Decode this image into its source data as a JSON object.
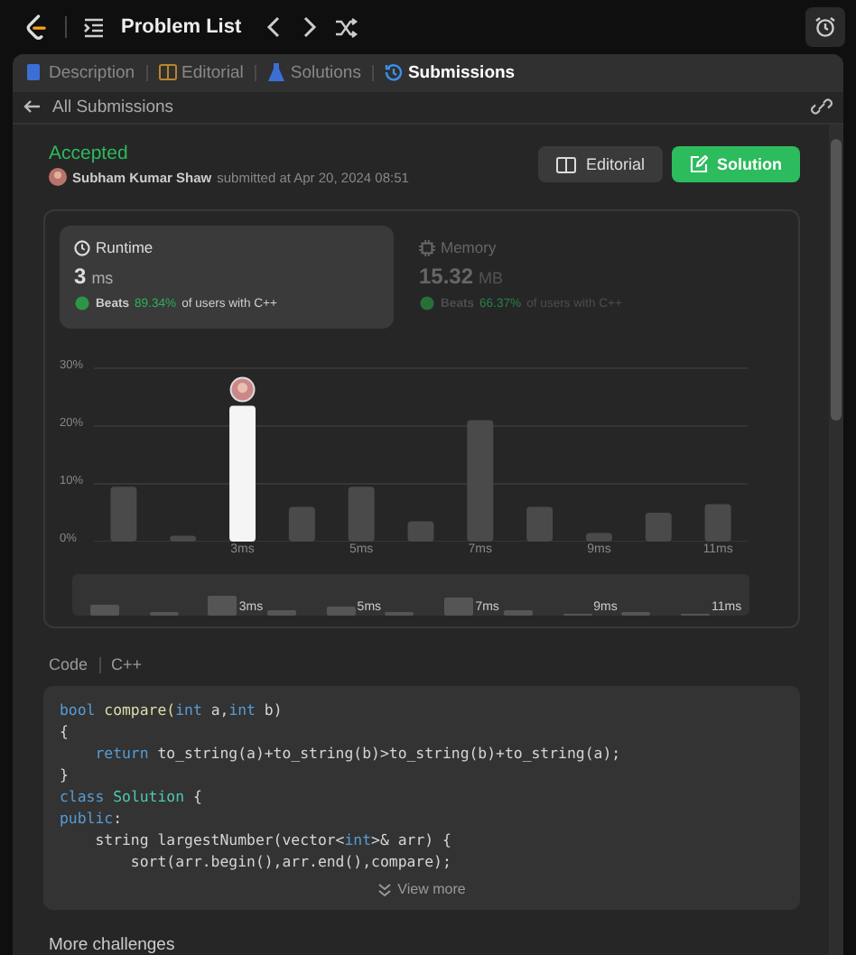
{
  "topbar": {
    "title": "Problem List"
  },
  "tabs": [
    {
      "label": "Description",
      "selected": false
    },
    {
      "label": "Editorial",
      "selected": false
    },
    {
      "label": "Solutions",
      "selected": false
    },
    {
      "label": "Submissions",
      "selected": true
    }
  ],
  "back_link": "All Submissions",
  "result": {
    "status": "Accepted",
    "user": "Subham Kumar Shaw",
    "submitted": "submitted at Apr 20, 2024 08:51"
  },
  "buttons": [
    {
      "label": "Editorial",
      "kind": "secondary"
    },
    {
      "label": "Solution",
      "kind": "primary"
    }
  ],
  "stats": [
    {
      "title": "Runtime",
      "value": "3",
      "unit": "ms",
      "beats_label": "Beats",
      "beats": "89.34%",
      "beats_suffix": "of users with C++",
      "selected": true
    },
    {
      "title": "Memory",
      "value": "15.32",
      "unit": "MB",
      "beats_label": "Beats",
      "beats": "66.37%",
      "beats_suffix": "of users with C++",
      "selected": false
    }
  ],
  "distribution": {
    "chart_data": {
      "type": "bar",
      "categories": [
        null,
        null,
        "3ms",
        null,
        "5ms",
        null,
        "7ms",
        null,
        "9ms",
        null,
        "11ms"
      ],
      "series": [
        {
          "color": "#4a4a4a",
          "values": [
            9.5,
            1,
            null,
            6,
            9.5,
            3.5,
            21,
            6,
            1.5,
            5,
            6.5
          ]
        },
        {
          "color": "#f5f5f5",
          "values": [
            null,
            null,
            23.5,
            null,
            null,
            null,
            null,
            null,
            null,
            null,
            null
          ]
        }
      ],
      "ylim": [
        0,
        30
      ],
      "yticks": [
        {
          "value": 0,
          "label": "0%"
        },
        {
          "value": 10,
          "label": "10%"
        },
        {
          "value": 20,
          "label": "20%"
        },
        {
          "value": 30,
          "label": "30%"
        }
      ]
    },
    "overview_labels": [
      "3ms",
      "5ms",
      "7ms",
      "9ms",
      "11ms"
    ]
  },
  "code": {
    "label": "Code",
    "language": "C++",
    "view_more": "View more",
    "lines": [
      [
        {
          "t": "bool",
          "kind": "kw"
        },
        {
          "t": " compare(",
          "kind": "fn"
        },
        {
          "t": "int",
          "kind": "kw"
        },
        {
          "t": " a,",
          "kind": "p"
        },
        {
          "t": "int",
          "kind": "kw"
        },
        {
          "t": " b)",
          "kind": "p"
        }
      ],
      [
        {
          "t": "{",
          "kind": "p"
        }
      ],
      [
        {
          "t": "    return",
          "kind": "kw"
        },
        {
          "t": " to_string(a)+to_string(b)>to_string(b)+to_string(a);",
          "kind": "p"
        }
      ],
      [
        {
          "t": "}",
          "kind": "p"
        }
      ],
      [
        {
          "t": "class",
          "kind": "kw"
        },
        {
          "t": " Solution",
          "kind": "type"
        },
        {
          "t": " {",
          "kind": "p"
        }
      ],
      [
        {
          "t": "public",
          "kind": "kw"
        },
        {
          "t": ":",
          "kind": "p"
        }
      ],
      [
        {
          "t": "    string largestNumber(vector<",
          "kind": "p"
        },
        {
          "t": "int",
          "kind": "kw"
        },
        {
          "t": ">& arr) {",
          "kind": "p"
        }
      ],
      [
        {
          "t": "        sort(arr.begin(),arr.end(),compare);",
          "kind": "p"
        }
      ]
    ]
  },
  "more": "More challenges"
}
